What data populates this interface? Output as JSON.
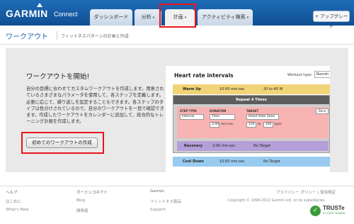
{
  "header": {
    "logo": "GARMIN",
    "logo_sub": "Connect",
    "tabs": [
      {
        "label": "ダッシュボード",
        "caret": ""
      },
      {
        "label": "分析",
        "caret": "▾"
      },
      {
        "label": "計画",
        "caret": "▾"
      },
      {
        "label": "アクティビティ検索",
        "caret": "▾"
      }
    ],
    "upgrade_label": "+ アップグレード"
  },
  "page": {
    "title": "ワークアウト",
    "subtitle": "フィットネスパターンの計画と作成"
  },
  "main": {
    "heading": "ワークアウトを開始!",
    "description": "自分の目標に合わせてカスタムワークアウトを作成します。用意されているさまざまなパラメータを使用して、各ステップを定義します。必要に応じて、繰り返しを設定することもできます。各ステップのタイプは色分けされているので、自分のワークアウトを一目で確認できます。作成したワークアウトをカレンダーに追加して、総合的なトレーニング計画を作成します。",
    "create_button": "初めてのワークアウトの作成"
  },
  "preview": {
    "title": "Heart rate intervals",
    "workout_type_label": "Workout type:",
    "workout_type_value": "Runnin",
    "warmup": {
      "name": "Warm Up",
      "duration": "10:00 min:sec",
      "target": "20 to 40 W"
    },
    "repeat_label": "Repeat 4 Times",
    "run": {
      "step_type_label": "STEP TYPE",
      "step_type_value": "Interval",
      "duration_label": "DURATION",
      "duration_value": "Time",
      "duration_time": "2:00",
      "duration_unit": "min:sec",
      "target_label": "TARGET",
      "target_value": "Heart Rate Zone",
      "target_from": "150",
      "target_to_word": "to",
      "target_to": "160",
      "target_unit": "bpm",
      "done_label": "Done"
    },
    "recovery": {
      "name": "Recovery",
      "duration": "2:00 min:sec",
      "target": "No Target"
    },
    "cooldown": {
      "name": "Cool Down",
      "duration": "10:00 min:sec",
      "target": "No Target"
    }
  },
  "footer": {
    "col1": {
      "head": "ヘルプ",
      "items": [
        "はじめに",
        "What's New"
      ]
    },
    "col2": {
      "head": "ガーミンコネクト",
      "items": [
        "Blog",
        "開発者"
      ]
    },
    "col3": {
      "head": "Garmin",
      "items": [
        "フィットネス製品",
        "Support"
      ]
    },
    "privacy": "プライバシー ポリシー | 使用規定",
    "copyright": "Copyright © 1996-2012 Garmin Ltd. or its subsidiaries",
    "truste_name": "TRUSTe",
    "truste_sub": "EU SAFE HARBOR"
  },
  "colors": {
    "header_blue": "#1565b5",
    "highlight_red": "#e8141b",
    "warmup": "#f2d478",
    "interval": "#f8b3b3",
    "recovery": "#b59fd8",
    "cooldown": "#99cbf0"
  }
}
